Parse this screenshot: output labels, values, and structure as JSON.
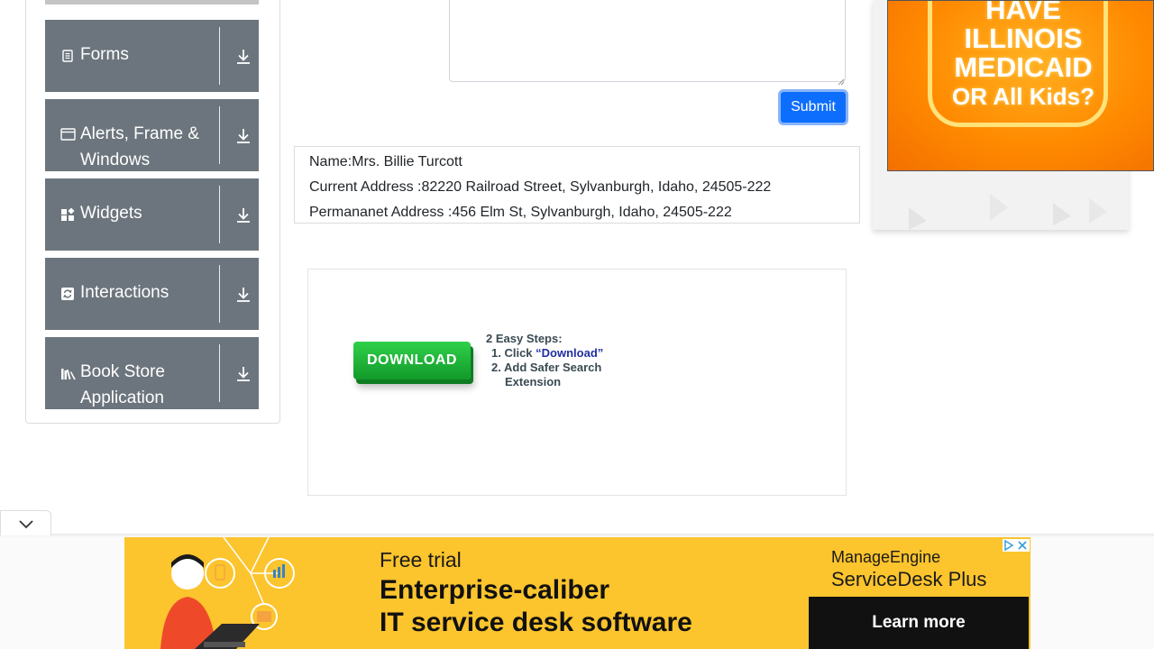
{
  "sidebar": {
    "groups": [
      {
        "label": "Forms",
        "icon": "document-icon"
      },
      {
        "label": "Alerts, Frame & Windows",
        "icon": "window-icon"
      },
      {
        "label": "Widgets",
        "icon": "widgets-icon"
      },
      {
        "label": "Interactions",
        "icon": "interactions-icon"
      },
      {
        "label": "Book Store Application",
        "icon": "books-icon"
      }
    ]
  },
  "form": {
    "submit_label": "Submit"
  },
  "output": {
    "name": "Name:Mrs. Billie Turcott",
    "current_address": "Current Address :82220 Railroad Street, Sylvanburgh, Idaho, 24505-222",
    "permanent_address": "Permananet Address :456 Elm St, Sylvanburgh, Idaho, 24505-222"
  },
  "ad_middle": {
    "button": "DOWNLOAD",
    "steps_title": "2 Easy Steps:",
    "step1_prefix": "Click ",
    "step1_link": "“Download”",
    "step2": "Add Safer Search",
    "step2_cont": "Extension"
  },
  "ad_right": {
    "line1": "HAVE",
    "line2": "ILLINOIS",
    "line3": "MEDICAID",
    "line4": "OR All Kids?"
  },
  "ad_bottom": {
    "free_trial": "Free trial",
    "headline1": "Enterprise-caliber",
    "headline2": "IT service desk software",
    "brand_top": "ManageEngine",
    "brand_name": "ServiceDesk Plus",
    "cta": "Learn more"
  },
  "colors": {
    "sidebar_group": "#6c757d",
    "submit": "#0d6efd",
    "banner": "#fcc42d"
  }
}
